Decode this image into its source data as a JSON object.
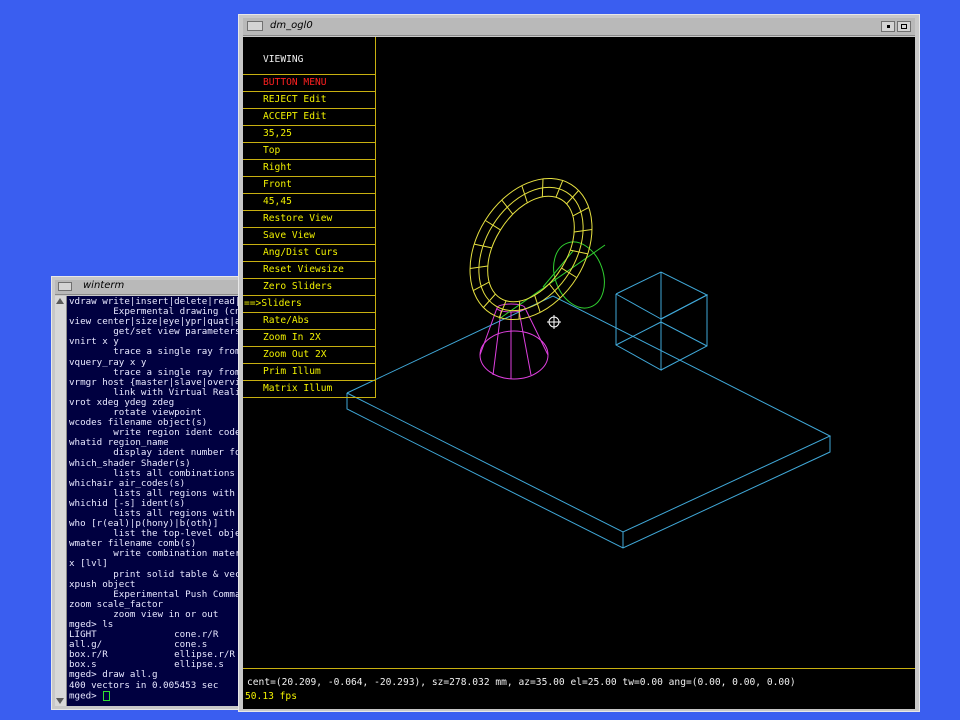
{
  "winterm": {
    "title": "winterm",
    "lines": [
      "vdraw write|insert|delete|read|",
      "        Expermental drawing (cnu",
      "view center|size|eye|ypr|quat|ae",
      "        get/set view parameters",
      "vnirt x y",
      "        trace a single ray from",
      "vquery_ray x y",
      "        trace a single ray from",
      "vrmgr host {master|slave|overvi",
      "        link with Virtual Reali",
      "vrot xdeg ydeg zdeg",
      "        rotate viewpoint",
      "wcodes filename object(s)",
      "        write region ident codes",
      "whatid region_name",
      "        display ident number fo",
      "which_shader Shader(s)",
      "        lists all combinations w",
      "whichair air_codes(s)",
      "        lists all regions with a",
      "whichid [-s] ident(s)",
      "        lists all regions with g",
      "who [r(eal)|p(hony)|b(oth)]",
      "        list the top-level obje",
      "wmater filename comb(s)",
      "        write combination mater",
      "x [lvl]",
      "        print solid table & vect",
      "xpush object",
      "        Experimental Push Comman",
      "zoom scale_factor",
      "        zoom view in or out",
      "mged> ls",
      "LIGHT              cone.r/R",
      "all.g/             cone.s",
      "box.r/R            ellipse.r/R",
      "box.s              ellipse.s",
      "mged> draw all.g",
      "400 vectors in 0.005453 sec"
    ],
    "prompt": "mged> ",
    "cursor_color": "#30e030"
  },
  "dm_ogl0": {
    "title": "dm_ogl0",
    "menu_header": "VIEWING",
    "menu_items": [
      {
        "label": "BUTTON MENU",
        "style": "red"
      },
      {
        "label": "REJECT Edit",
        "style": "normal"
      },
      {
        "label": "ACCEPT Edit",
        "style": "normal"
      },
      {
        "label": "35,25",
        "style": "normal"
      },
      {
        "label": "Top",
        "style": "normal"
      },
      {
        "label": "Right",
        "style": "normal"
      },
      {
        "label": "Front",
        "style": "normal"
      },
      {
        "label": "45,45",
        "style": "normal"
      },
      {
        "label": "Restore View",
        "style": "normal"
      },
      {
        "label": "Save View",
        "style": "normal"
      },
      {
        "label": "Ang/Dist Curs",
        "style": "normal"
      },
      {
        "label": "Reset Viewsize",
        "style": "normal"
      },
      {
        "label": "Zero Sliders",
        "style": "normal"
      },
      {
        "label": "==>Sliders",
        "style": "selected"
      },
      {
        "label": "Rate/Abs",
        "style": "normal"
      },
      {
        "label": "Zoom In 2X",
        "style": "normal"
      },
      {
        "label": "Zoom Out 2X",
        "style": "normal"
      },
      {
        "label": "Prim Illum",
        "style": "normal"
      },
      {
        "label": "Matrix Illum",
        "style": "normal"
      }
    ],
    "status": "cent=(20.209, -0.064, -20.293), sz=278.032 mm, az=35.00 el=25.00 tw=0.00 ang=(0.00, 0.00, 0.00)",
    "fps": "50.13 fps"
  },
  "colors": {
    "desktop": "#3a5ef0",
    "menu_text": "#f0f000",
    "menu_highlight": "#ff2020",
    "torus": "#e6e040",
    "ellipsoid": "#30d030",
    "cone": "#e040e0",
    "box": "#40a8d8",
    "plate": "#40a8d8"
  }
}
